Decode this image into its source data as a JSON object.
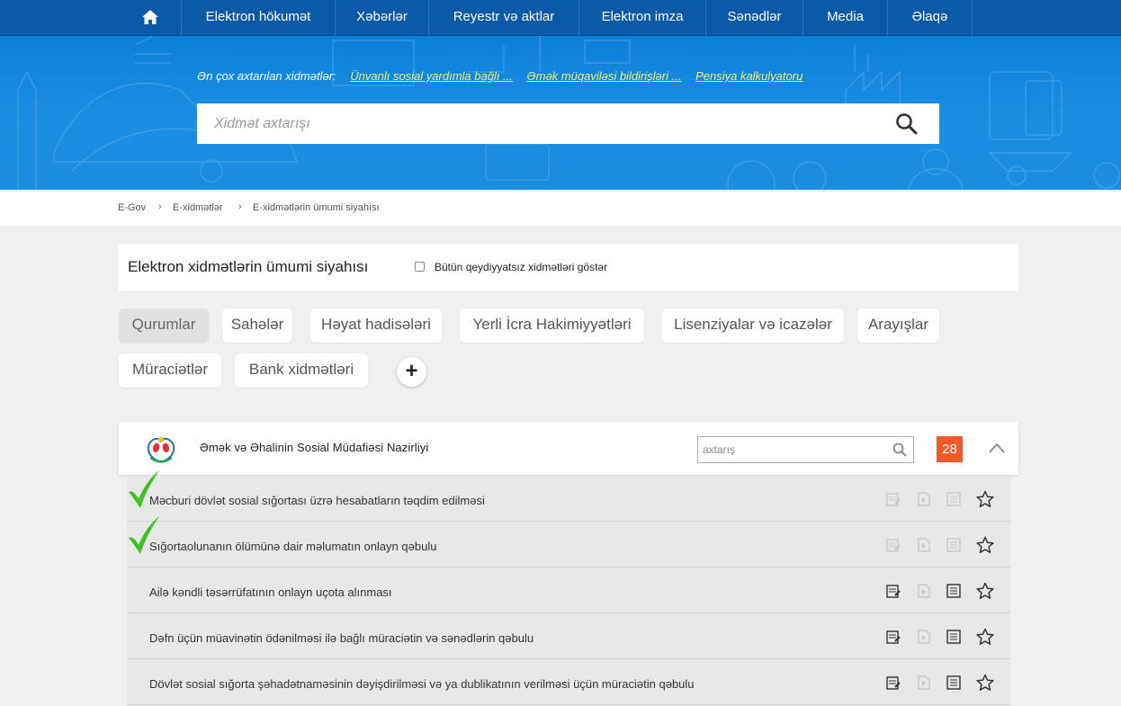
{
  "nav": {
    "home_icon": "home-icon",
    "items": [
      "Elektron hökumət",
      "Xəbərlər",
      "Reyestr və aktlar",
      "Elektron imza",
      "Sənədlər",
      "Media",
      "Əlaqə"
    ]
  },
  "hero": {
    "popular_label": "Ən çox axtarılan xidmətlər:",
    "popular_links": [
      "Ünvanlı sosial yardımla bağlı ...",
      "Əmək müqaviləsi bildirişləri ...",
      "Pensiya kalkulyatoru"
    ],
    "search_placeholder": "Xidmət axtarışı",
    "search_icon": "search-icon"
  },
  "breadcrumb": [
    "E-Gov",
    "E-xidmətlər",
    "E-xidmətlərin ümumi siyahısı"
  ],
  "list_panel": {
    "title": "Elektron xidmətlərin ümumi siyahısı",
    "checkbox_label": "Bütün qeydiyyatsız xidmətləri göstər"
  },
  "filters": {
    "tabs": [
      "Qurumlar",
      "Sahələr",
      "Həyat hadisələri",
      "Yerli İcra Hakimiyyətləri",
      "Lisenziyalar və icazələr",
      "Arayışlar",
      "Müraciətlər",
      "Bank xidmətləri"
    ],
    "active": "Qurumlar",
    "add_label": "+"
  },
  "organization": {
    "name": "Əmək və Əhalinin Sosial Müdafiəsi Nazirliyi",
    "search_placeholder": "axtarış",
    "count": "28"
  },
  "services": [
    {
      "title": "Məcburi dövlət sosial sığortası üzrə hesabatların təqdim edilməsi",
      "enabled": false,
      "checked": true
    },
    {
      "title": "Sığortaolunanın ölümünə dair məlumatın onlayn qəbulu",
      "enabled": false,
      "checked": true
    },
    {
      "title": "Ailə kəndli təsərrüfatının onlayn uçota alınması",
      "enabled": true,
      "checked": false
    },
    {
      "title": "Dəfn üçün müavinətin ödənilməsi ilə bağlı müraciətin və sənədlərin qəbulu",
      "enabled": true,
      "checked": false
    },
    {
      "title": "Dövlət sosial sığorta şəhadətnaməsinin dəyişdirilməsi və ya dublikatının verilməsi üçün müraciətin qəbulu",
      "enabled": true,
      "checked": false
    }
  ],
  "colors": {
    "nav_bg": "#0a5aa8",
    "hero_bg": "#1a8fe3",
    "link_yellow": "#f6f066",
    "badge_orange": "#f05a28",
    "check_green": "#3cc21a"
  }
}
